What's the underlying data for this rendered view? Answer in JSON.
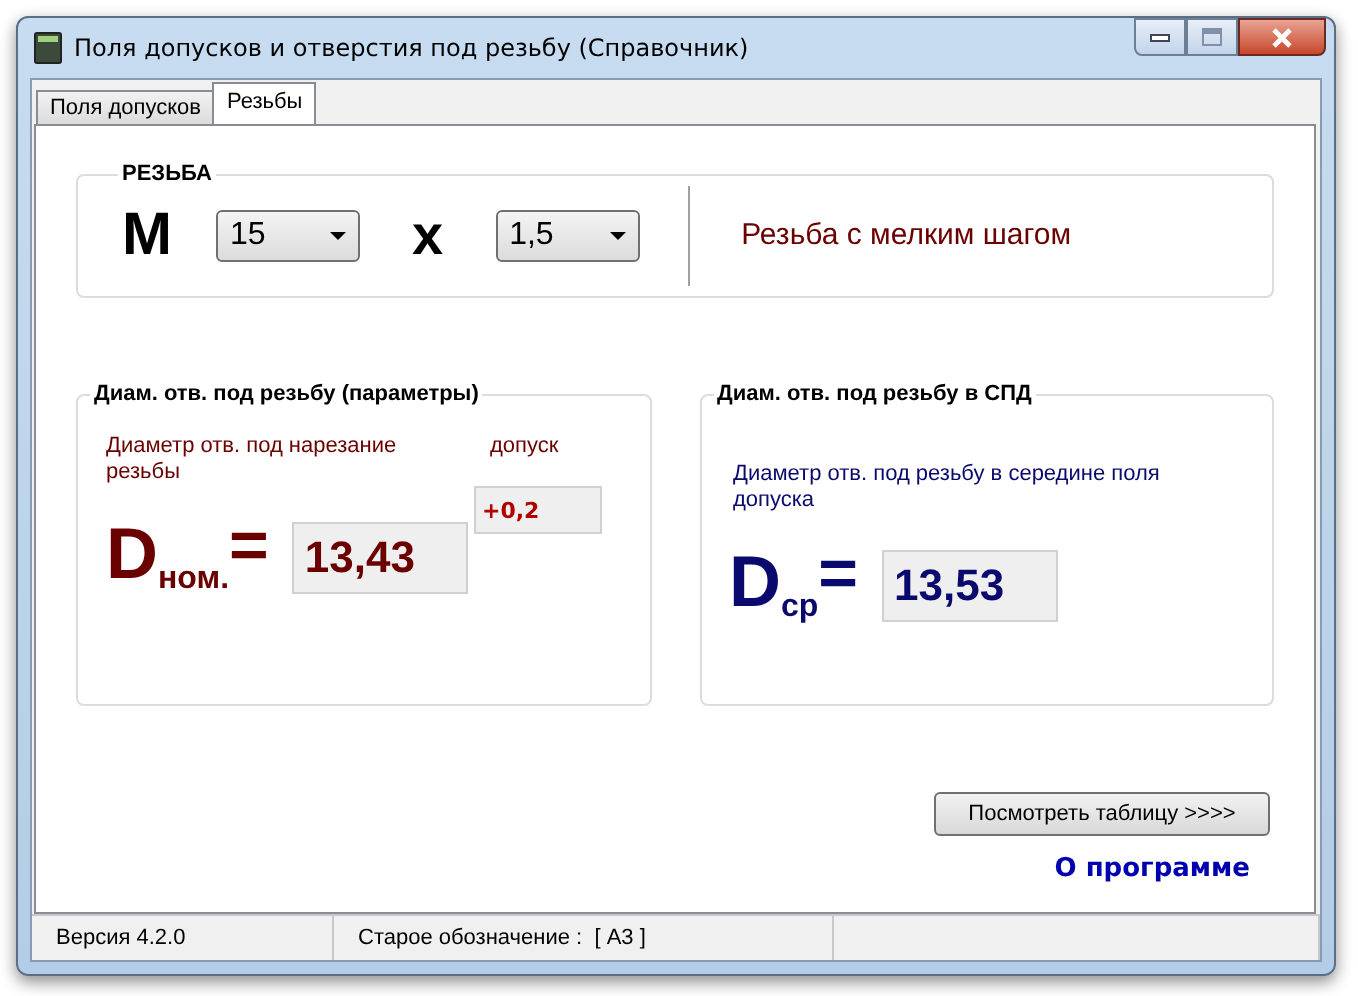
{
  "window": {
    "title": "Поля допусков и отверстия под резьбу (Справочник)"
  },
  "tabs": [
    {
      "label": "Поля допусков",
      "selected": false
    },
    {
      "label": "Резьбы",
      "selected": true
    }
  ],
  "thread": {
    "group_label": "РЕЗЬБА",
    "prefix": "M",
    "diameter": "15",
    "separator": "x",
    "pitch": "1,5",
    "description": "Резьба с мелким шагом"
  },
  "nominal": {
    "group_label": "Диам. отв. под резьбу (параметры)",
    "caption": "Диаметр отв. под нарезание резьбы",
    "tolerance_label": "допуск",
    "tolerance": "+0,2",
    "symbol": "D",
    "subscript": "ном.",
    "equals": "=",
    "value": "13,43"
  },
  "middle": {
    "group_label": "Диам. отв. под резьбу в СПД",
    "caption": "Диаметр отв. под резьбу в середине поля допуска",
    "symbol": "D",
    "subscript": "ср",
    "equals": "=",
    "value": "13,53"
  },
  "table_button": {
    "label": "Посмотреть таблицу >>>>"
  },
  "about_link": {
    "label": "О программе"
  },
  "status_bar": [
    {
      "text": "Версия 4.2.0"
    },
    {
      "text": "Старое обозначение :  [ А3 ]"
    }
  ]
}
